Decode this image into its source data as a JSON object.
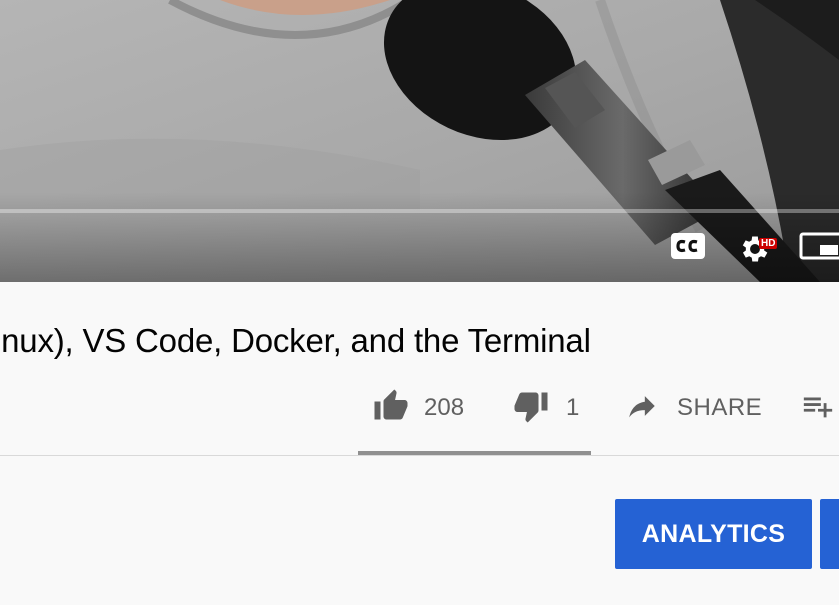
{
  "video": {
    "title": "inux), VS Code, Docker, and the Terminal",
    "hd_badge": "HD"
  },
  "player_controls": {
    "cc_icon": "closed-captions-icon",
    "settings_icon": "gear-icon",
    "miniplayer_icon": "miniplayer-icon"
  },
  "actions": {
    "like_count": "208",
    "dislike_count": "1",
    "share_label": "SHARE",
    "like_icon": "thumb-up-icon",
    "dislike_icon": "thumb-down-icon",
    "share_icon": "share-arrow-icon",
    "save_icon": "playlist-add-icon"
  },
  "owner": {
    "analytics_label": "ANALYTICS"
  },
  "colors": {
    "button_blue": "#2562d4",
    "icon_gray": "#606060",
    "hd_red": "#cc0000"
  }
}
